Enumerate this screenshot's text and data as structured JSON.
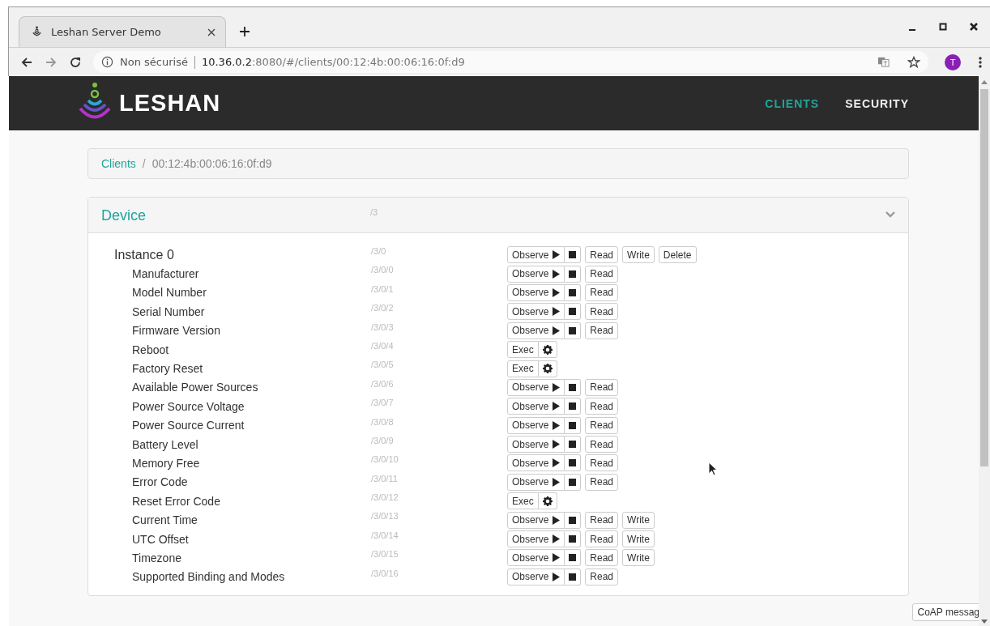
{
  "browser": {
    "tab": {
      "title": "Leshan Server Demo",
      "selected": true
    },
    "security": "Non sécurisé",
    "url_host": "10.36.0.2",
    "url_rest": ":8080/#/clients/00:12:4b:00:06:16:0f:d9",
    "avatar": "T"
  },
  "navbar": {
    "brand": "LESHAN",
    "links": [
      {
        "label": "CLIENTS",
        "selected": true
      },
      {
        "label": "SECURITY",
        "selected": false
      }
    ]
  },
  "breadcrumb": [
    {
      "label": "Clients",
      "kind": "link"
    },
    {
      "label": "/",
      "kind": "separator"
    },
    {
      "label": "00:12:4b:00:06:16:0f:d9",
      "kind": "current"
    }
  ],
  "object": {
    "name": "Device",
    "path": "/3",
    "expanded": true,
    "instance": {
      "name": "Instance 0",
      "path": "/3/0",
      "ops": [
        {
          "kind": "observe",
          "label": "Observe"
        },
        {
          "kind": "read",
          "label": "Read"
        },
        {
          "kind": "write",
          "label": "Write"
        },
        {
          "kind": "delete",
          "label": "Delete"
        }
      ]
    },
    "resources": [
      {
        "name": "Manufacturer",
        "path": "/3/0/0",
        "ops": [
          {
            "kind": "observe",
            "label": "Observe"
          },
          {
            "kind": "read",
            "label": "Read"
          }
        ]
      },
      {
        "name": "Model Number",
        "path": "/3/0/1",
        "ops": [
          {
            "kind": "observe",
            "label": "Observe"
          },
          {
            "kind": "read",
            "label": "Read"
          }
        ]
      },
      {
        "name": "Serial Number",
        "path": "/3/0/2",
        "ops": [
          {
            "kind": "observe",
            "label": "Observe"
          },
          {
            "kind": "read",
            "label": "Read"
          }
        ]
      },
      {
        "name": "Firmware Version",
        "path": "/3/0/3",
        "ops": [
          {
            "kind": "observe",
            "label": "Observe"
          },
          {
            "kind": "read",
            "label": "Read"
          }
        ]
      },
      {
        "name": "Reboot",
        "path": "/3/0/4",
        "ops": [
          {
            "kind": "exec",
            "label": "Exec"
          }
        ]
      },
      {
        "name": "Factory Reset",
        "path": "/3/0/5",
        "ops": [
          {
            "kind": "exec",
            "label": "Exec"
          }
        ]
      },
      {
        "name": "Available Power Sources",
        "path": "/3/0/6",
        "ops": [
          {
            "kind": "observe",
            "label": "Observe"
          },
          {
            "kind": "read",
            "label": "Read"
          }
        ]
      },
      {
        "name": "Power Source Voltage",
        "path": "/3/0/7",
        "ops": [
          {
            "kind": "observe",
            "label": "Observe"
          },
          {
            "kind": "read",
            "label": "Read"
          }
        ]
      },
      {
        "name": "Power Source Current",
        "path": "/3/0/8",
        "ops": [
          {
            "kind": "observe",
            "label": "Observe"
          },
          {
            "kind": "read",
            "label": "Read"
          }
        ]
      },
      {
        "name": "Battery Level",
        "path": "/3/0/9",
        "ops": [
          {
            "kind": "observe",
            "label": "Observe"
          },
          {
            "kind": "read",
            "label": "Read"
          }
        ]
      },
      {
        "name": "Memory Free",
        "path": "/3/0/10",
        "ops": [
          {
            "kind": "observe",
            "label": "Observe"
          },
          {
            "kind": "read",
            "label": "Read"
          }
        ]
      },
      {
        "name": "Error Code",
        "path": "/3/0/11",
        "ops": [
          {
            "kind": "observe",
            "label": "Observe"
          },
          {
            "kind": "read",
            "label": "Read"
          }
        ]
      },
      {
        "name": "Reset Error Code",
        "path": "/3/0/12",
        "ops": [
          {
            "kind": "exec",
            "label": "Exec"
          }
        ]
      },
      {
        "name": "Current Time",
        "path": "/3/0/13",
        "ops": [
          {
            "kind": "observe",
            "label": "Observe"
          },
          {
            "kind": "read",
            "label": "Read"
          },
          {
            "kind": "write",
            "label": "Write"
          }
        ]
      },
      {
        "name": "UTC Offset",
        "path": "/3/0/14",
        "ops": [
          {
            "kind": "observe",
            "label": "Observe"
          },
          {
            "kind": "read",
            "label": "Read"
          },
          {
            "kind": "write",
            "label": "Write"
          }
        ]
      },
      {
        "name": "Timezone",
        "path": "/3/0/15",
        "ops": [
          {
            "kind": "observe",
            "label": "Observe"
          },
          {
            "kind": "read",
            "label": "Read"
          },
          {
            "kind": "write",
            "label": "Write"
          }
        ]
      },
      {
        "name": "Supported Binding and Modes",
        "path": "/3/0/16",
        "ops": [
          {
            "kind": "observe",
            "label": "Observe"
          },
          {
            "kind": "read",
            "label": "Read"
          }
        ]
      }
    ]
  },
  "coap_button": "CoAP messag"
}
